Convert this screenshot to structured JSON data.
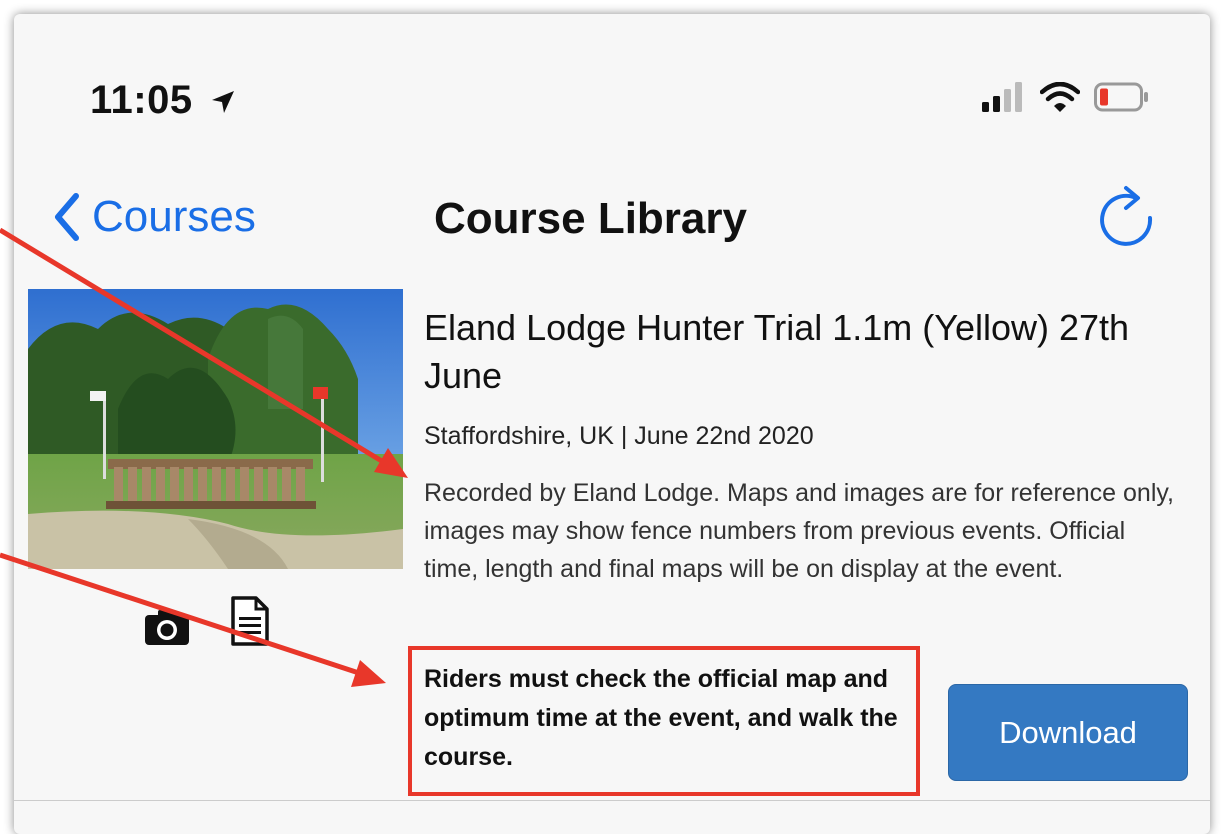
{
  "status_bar": {
    "time": "11:05",
    "location_icon": "location-arrow-icon",
    "signal_icon": "cellular-signal-icon",
    "wifi_icon": "wifi-icon",
    "battery_icon": "battery-low-icon"
  },
  "nav": {
    "back_label": "Courses",
    "title": "Course Library",
    "refresh_icon": "refresh-icon"
  },
  "course": {
    "title": "Eland Lodge Hunter Trial 1.1m (Yellow) 27th June",
    "meta": "Staffordshire, UK | June 22nd 2020",
    "description": "Recorded by Eland Lodge. Maps and images are for reference only, images may show fence numbers from previous events. Official time, length and final maps will be on display at the event.",
    "warning": "Riders must check the official map and optimum time at the event, and walk the course.",
    "download_label": "Download",
    "thumb_icons": [
      "camera-icon",
      "document-icon"
    ]
  },
  "colors": {
    "ios_blue": "#1a6ee6",
    "button_blue": "#3479c2",
    "annotation_red": "#e8372a",
    "battery_red": "#e8372a"
  }
}
